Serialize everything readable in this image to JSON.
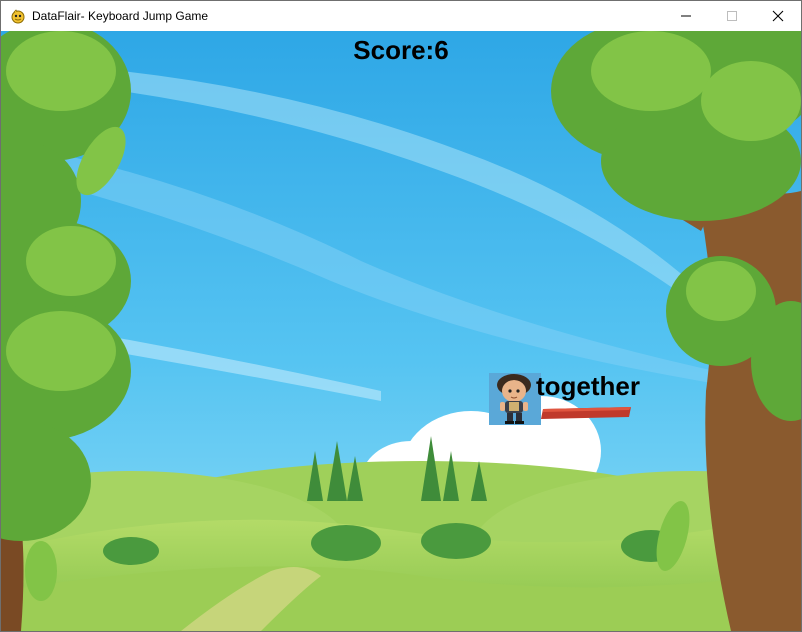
{
  "window": {
    "title": "DataFlair- Keyboard Jump Game",
    "icons": {
      "app": "pygame-snake-icon",
      "minimize": "minimize-icon",
      "maximize": "maximize-icon",
      "close": "close-icon"
    }
  },
  "game": {
    "score_text": "Score:6",
    "current_word": "together",
    "player_sprite": "boy-character",
    "platform_color": "#c0392b",
    "sky_color": "#3fb4ea"
  }
}
